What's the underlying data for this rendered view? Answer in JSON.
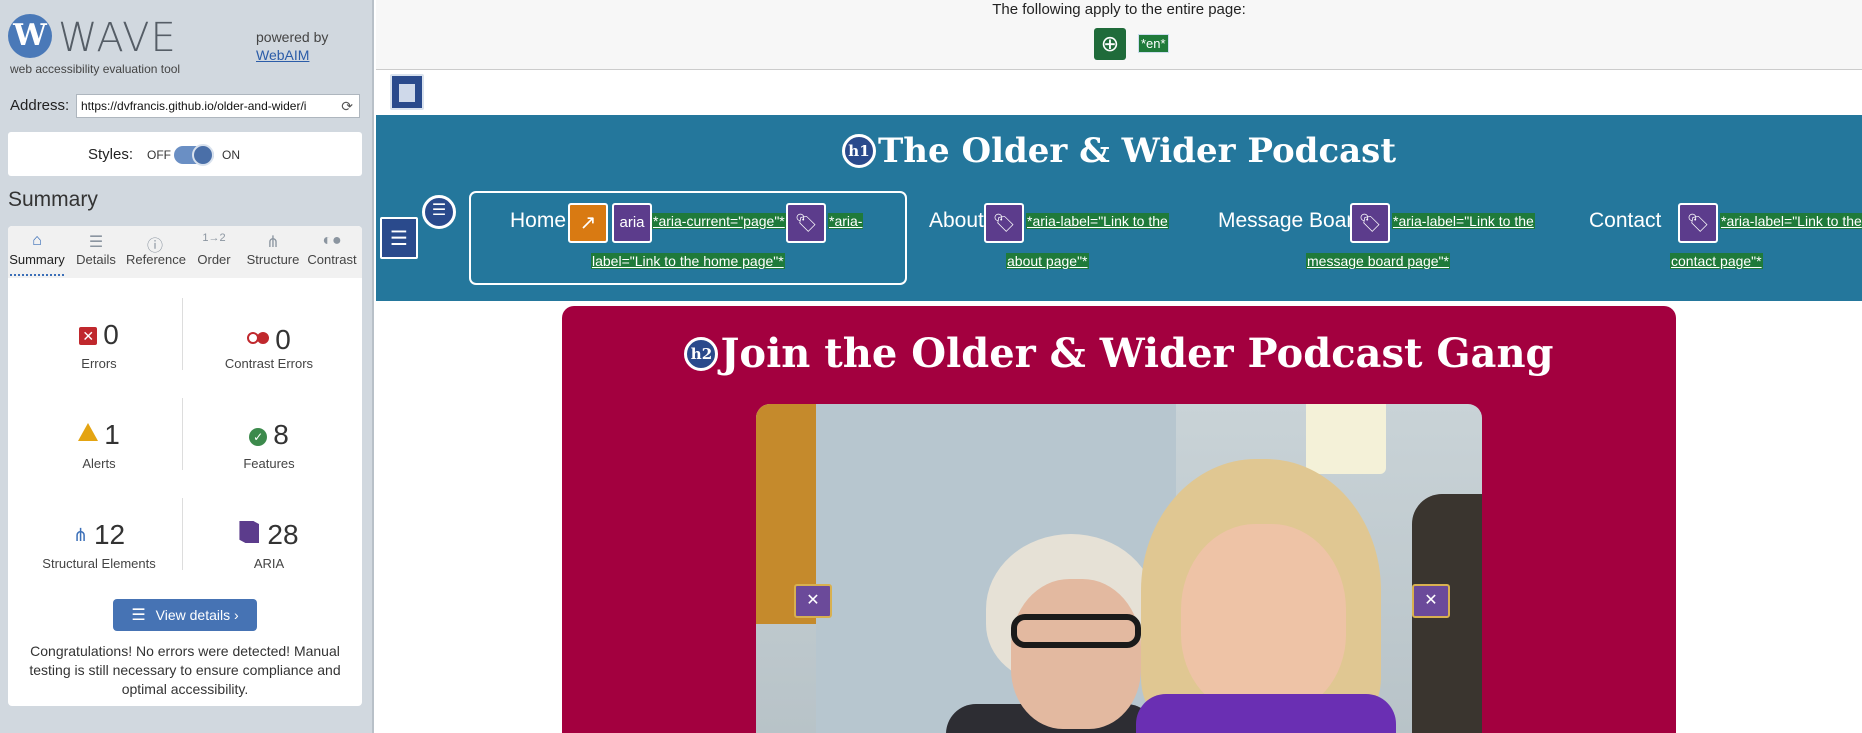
{
  "wave": {
    "logo_letter": "W",
    "logo_text": "WAVE",
    "logo_subtitle": "web accessibility evaluation tool",
    "powered_by": "powered by",
    "webaim_link": "WebAIM",
    "address_label": "Address:",
    "address_value": "https://dvfrancis.github.io/older-and-wider/i",
    "styles_label": "Styles:",
    "styles_off": "OFF",
    "styles_on": "ON",
    "summary_title": "Summary",
    "tabs": [
      {
        "label": "Summary",
        "icon": "home-icon"
      },
      {
        "label": "Details",
        "icon": "list-icon"
      },
      {
        "label": "Reference",
        "icon": "info-icon"
      },
      {
        "label": "Order",
        "icon": "order-icon"
      },
      {
        "label": "Structure",
        "icon": "structure-icon"
      },
      {
        "label": "Contrast",
        "icon": "contrast-icon"
      }
    ],
    "stats": {
      "errors": {
        "value": "0",
        "label": "Errors"
      },
      "contrast_errors": {
        "value": "0",
        "label": "Contrast Errors"
      },
      "alerts": {
        "value": "1",
        "label": "Alerts"
      },
      "features": {
        "value": "8",
        "label": "Features"
      },
      "structural": {
        "value": "12",
        "label": "Structural Elements"
      },
      "aria": {
        "value": "28",
        "label": "ARIA"
      }
    },
    "view_details": "View details ›",
    "congrats": "Congratulations! No errors were detected! Manual testing is still necessary to ensure compliance and optimal accessibility."
  },
  "page": {
    "entire_page_msg": "The following apply to the entire page:",
    "lang_tag": "*en*",
    "site_title": "The Older & Wider Podcast",
    "h1_badge": "h1",
    "h2_badge": "h2",
    "aria_badge": "aria",
    "nav": {
      "home": "Home",
      "about": "About",
      "message_board": "Message Board",
      "contact": "Contact"
    },
    "notes": {
      "home_current": "*aria-current=\"page\"*",
      "home_label_a": "*aria-",
      "home_label_b": "label=\"Link to the home page\"*",
      "about_a": "*aria-label=\"Link to the",
      "about_b": "about page\"*",
      "board_a": "*aria-label=\"Link to the",
      "board_b": "message board page\"*",
      "contact_a": "*aria-label=\"Link to the",
      "contact_b": "contact page\"*"
    },
    "hero_title": "Join the Older & Wider Podcast Gang"
  },
  "colors": {
    "header_bg": "#24779c",
    "hero_bg": "#a3003f",
    "feature_green": "#1f7a3a",
    "aria_purple": "#5c3c8c",
    "structure_blue": "#2a4a8c"
  }
}
